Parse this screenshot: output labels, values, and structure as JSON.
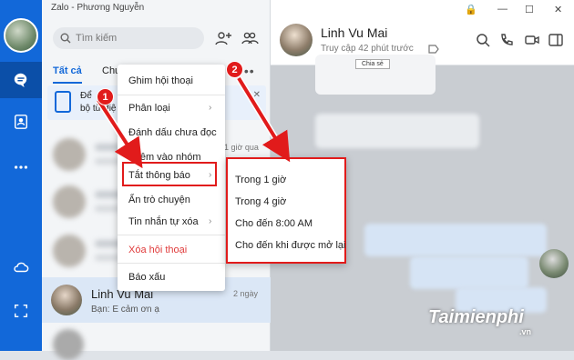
{
  "window": {
    "title": "Zalo - Phương Nguyễn"
  },
  "search": {
    "placeholder": "Tìm kiếm"
  },
  "tabs": [
    {
      "label": "Tất cả"
    },
    {
      "label": "Chưa đọ"
    }
  ],
  "banner": {
    "line1": "Để",
    "line2": "bộ từ điệ"
  },
  "background_time": "1 giờ qua",
  "context_menu": {
    "items": [
      {
        "label": "Ghim hội thoại"
      },
      {
        "label": "Phân loại"
      },
      {
        "label": "Đánh dấu chưa đọc"
      },
      {
        "label": "Thêm vào nhóm"
      },
      {
        "label": "Tắt thông báo"
      },
      {
        "label": "Ẩn trò chuyện"
      },
      {
        "label": "Tin nhắn tự xóa"
      },
      {
        "label": "Xóa hội thoại"
      },
      {
        "label": "Báo xấu"
      }
    ]
  },
  "submenu": {
    "items": [
      {
        "label": "Trong 1 giờ"
      },
      {
        "label": "Trong 4 giờ"
      },
      {
        "label": "Cho đến 8:00 AM"
      },
      {
        "label": "Cho đến khi được mở lại"
      }
    ]
  },
  "badges": {
    "one": "1",
    "two": "2"
  },
  "contact": {
    "name": "Linh Vu Mai",
    "preview": "Bạn: E cảm ơn ạ",
    "time": "2 ngày"
  },
  "chat": {
    "name": "Linh Vu Mai",
    "status": "Truy cập 42 phút trước",
    "share_label": "Chia sẻ"
  },
  "watermark": {
    "brand": "Taimienphi",
    "domain": ".vn"
  },
  "colors": {
    "accent": "#1268d9",
    "highlight": "#e11b1b"
  }
}
